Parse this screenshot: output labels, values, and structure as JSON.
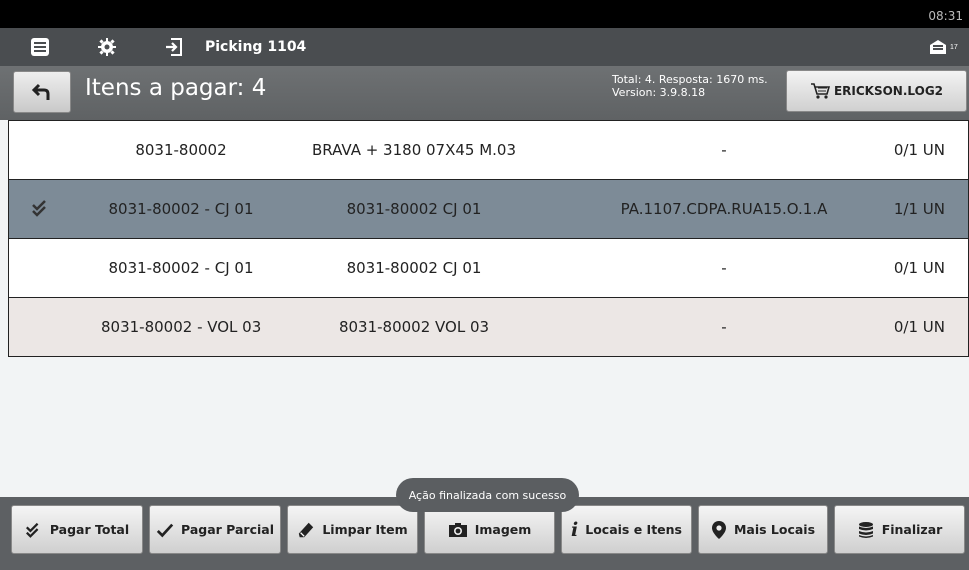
{
  "status": {
    "time": "08:31"
  },
  "actionbar": {
    "title": "Picking 1104",
    "notification_count": "17"
  },
  "header": {
    "title": "Itens a pagar: 4",
    "info_line1": "Total: 4. Resposta: 1670 ms.",
    "info_line2": "Version: 3.9.8.18",
    "user_label": "ERICKSON.LOG2"
  },
  "rows": [
    {
      "code": "8031-80002",
      "desc": "BRAVA + 3180 07X45 M.03",
      "loc": "-",
      "qty": "0/1 UN"
    },
    {
      "code": "8031-80002 - CJ 01",
      "desc": "8031-80002 CJ 01",
      "loc": "PA.1107.CDPA.RUA15.O.1.A",
      "qty": "1/1 UN"
    },
    {
      "code": "8031-80002 - CJ 01",
      "desc": "8031-80002 CJ 01",
      "loc": "-",
      "qty": "0/1 UN"
    },
    {
      "code": "8031-80002 - VOL 03",
      "desc": "8031-80002 VOL 03",
      "loc": "-",
      "qty": "0/1 UN"
    }
  ],
  "toast": "Ação finalizada com sucesso",
  "buttons": {
    "pagar_total": "Pagar Total",
    "pagar_parcial": "Pagar Parcial",
    "limpar_item": "Limpar Item",
    "imagem": "Imagem",
    "locais_itens": "Locais e Itens",
    "mais_locais": "Mais Locais",
    "finalizar": "Finalizar"
  },
  "icons": {
    "menu": "menu-icon",
    "settings": "gear-icon",
    "logout": "logout-icon",
    "messages": "message-icon",
    "back": "undo-icon",
    "cart": "cart-icon",
    "check": "double-check-icon"
  },
  "colors": {
    "selected_row": "#7d8b97",
    "beige_row": "#ece7e5",
    "bar": "#4a4d50"
  }
}
